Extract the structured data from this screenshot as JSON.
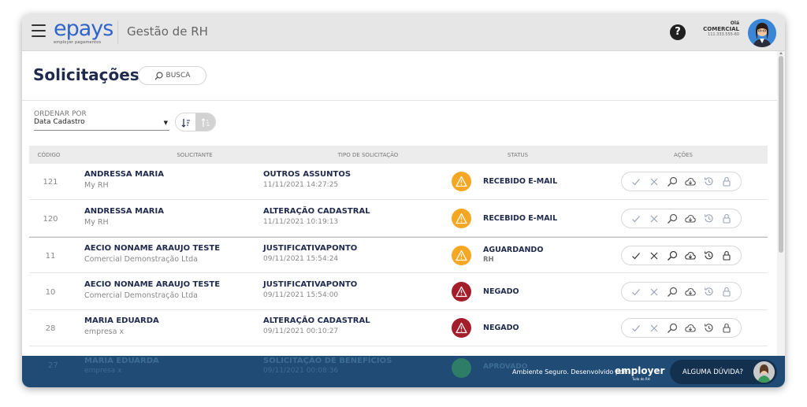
{
  "app": {
    "logo": "epays",
    "logo_sub": "employer pagamentos",
    "title": "Gestão de RH"
  },
  "user": {
    "greeting": "Olá",
    "name": "COMERCIAL",
    "id": "111.333.555-60"
  },
  "page": {
    "title": "Solicitações",
    "search_label": "BUSCA"
  },
  "sort": {
    "label": "ORDENAR POR",
    "selected": "Data Cadastro"
  },
  "table": {
    "headers": {
      "code": "CÓDIGO",
      "requester": "SOLICITANTE",
      "type": "TIPO DE SOLICITAÇÃO",
      "status": "STATUS",
      "actions": "AÇÕES"
    },
    "rows": [
      {
        "code": "121",
        "name": "ANDRESSA MARIA",
        "company": "My RH",
        "type": "OUTROS ASSUNTOS",
        "date": "11/11/2021 14:27:25",
        "status": "RECEBIDO E-MAIL",
        "status_sub": "",
        "status_kind": "warning"
      },
      {
        "code": "120",
        "name": "ANDRESSA MARIA",
        "company": "My RH",
        "type": "ALTERAÇÃO CADASTRAL",
        "date": "11/11/2021 10:19:13",
        "status": "RECEBIDO E-MAIL",
        "status_sub": "",
        "status_kind": "warning"
      },
      {
        "code": "11",
        "name": "AECIO NONAME ARAUJO TESTE",
        "company": "Comercial Demonstração Ltda",
        "type": "JUSTIFICATIVAPONTO",
        "date": "09/11/2021 15:54:24",
        "status": "AGUARDANDO",
        "status_sub": "RH",
        "status_kind": "warning"
      },
      {
        "code": "10",
        "name": "AECIO NONAME ARAUJO TESTE",
        "company": "Comercial Demonstração Ltda",
        "type": "JUSTIFICATIVAPONTO",
        "date": "09/11/2021 15:54:00",
        "status": "NEGADO",
        "status_sub": "",
        "status_kind": "denied"
      },
      {
        "code": "28",
        "name": "MARIA EDUARDA",
        "company": "empresa x",
        "type": "ALTERAÇÃO CADASTRAL",
        "date": "09/11/2021 00:10:27",
        "status": "NEGADO",
        "status_sub": "",
        "status_kind": "denied"
      }
    ],
    "partial_row": {
      "code": "27",
      "name": "MARIA EDUARDA",
      "company": "empresa x",
      "type": "SOLICITAÇÃO DE BENEFÍCIOS",
      "date": "09/11/2021 00:08:36",
      "status": "APROVADO"
    }
  },
  "footer": {
    "secure_text": "Ambiente Seguro. Desenvolvido por:",
    "brand": "employer",
    "brand_sub": "Tudo do RH",
    "help_label": "ALGUMA DÚVIDA?"
  },
  "icons": [
    "menu-icon",
    "help-icon",
    "search-icon",
    "sort-ascending-icon",
    "sort-descending-icon",
    "warning-icon",
    "approve-icon",
    "reject-icon",
    "view-icon",
    "cloud-download-icon",
    "history-icon",
    "lock-icon"
  ],
  "colors": {
    "primary": "#1f2a4d",
    "warning": "#f5a623",
    "denied": "#a31e2a",
    "footer": "#1f4b75",
    "logo": "#2f64c8"
  }
}
